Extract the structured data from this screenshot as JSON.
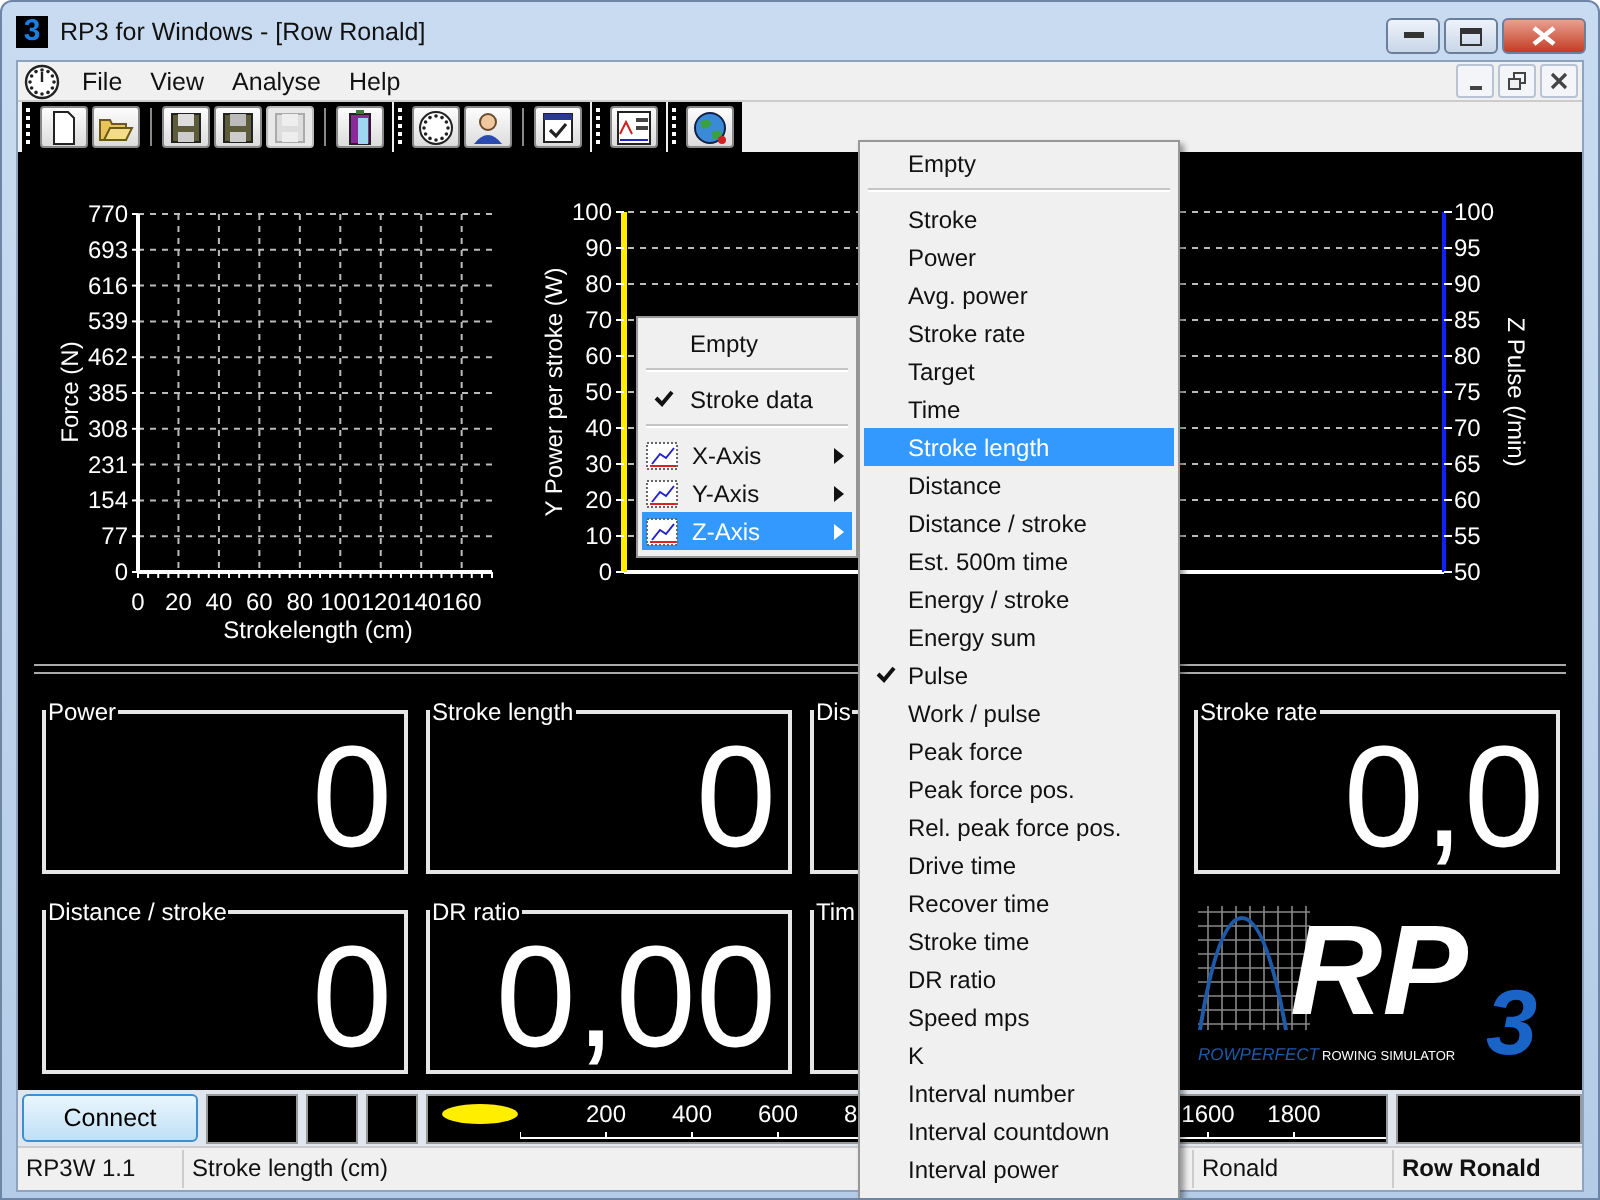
{
  "window": {
    "icon_glyph": "3",
    "title": "RP3 for Windows - [Row Ronald]"
  },
  "menu_bar": [
    {
      "label": "File"
    },
    {
      "label": "View"
    },
    {
      "label": "Analyse"
    },
    {
      "label": "Help"
    }
  ],
  "toolbar": [
    {
      "items": [
        {
          "kind": "new",
          "disabled": false
        },
        {
          "kind": "open",
          "disabled": false
        },
        {
          "kind": "separator"
        },
        {
          "kind": "save",
          "disabled": false
        },
        {
          "kind": "save-as",
          "disabled": false
        },
        {
          "kind": "save",
          "disabled": true
        },
        {
          "kind": "separator"
        },
        {
          "kind": "door",
          "disabled": false
        }
      ]
    },
    {
      "items": [
        {
          "kind": "gauge",
          "disabled": false
        },
        {
          "kind": "person",
          "disabled": false
        },
        {
          "kind": "separator"
        },
        {
          "kind": "checklist",
          "disabled": false
        }
      ]
    },
    {
      "items": [
        {
          "kind": "chart",
          "disabled": false
        }
      ]
    },
    {
      "items": [
        {
          "kind": "globe",
          "disabled": false
        }
      ]
    }
  ],
  "force_chart": {
    "chart_data": {
      "type": "line",
      "grid": true,
      "xlabel": "Strokelength (cm)",
      "ylabel": "Force (N)",
      "xlim": [
        0,
        175
      ],
      "ylim": [
        0,
        770
      ],
      "xticks": [
        0,
        20,
        40,
        60,
        80,
        100,
        120,
        140,
        160
      ],
      "yticks": [
        0,
        77,
        154,
        231,
        308,
        385,
        462,
        539,
        616,
        693,
        770
      ]
    }
  },
  "power_chart": {
    "chart_data": {
      "type": "line",
      "grid": true,
      "categories": [
        null
      ],
      "ylabel": "Y  Power per stroke (W)",
      "ylim": [
        0,
        100
      ],
      "yticks": [
        0,
        10,
        20,
        30,
        40,
        50,
        60,
        70,
        80,
        90,
        100
      ]
    },
    "z_axis": {
      "title": "Z Pulse (/min)",
      "ticks": [
        "100",
        "95",
        "90",
        "85",
        "80",
        "75",
        "70",
        "65",
        "60",
        "55",
        "50"
      ]
    }
  },
  "tiles": [
    {
      "kind": "full",
      "label": "Power",
      "value": "0"
    },
    {
      "kind": "full",
      "label": "Stroke length",
      "value": "0"
    },
    {
      "kind": "partial",
      "label": "Dis"
    },
    {
      "kind": "full",
      "label": "Stroke rate",
      "value": "0,0"
    },
    {
      "kind": "full",
      "label": "Distance / stroke",
      "value": "0"
    },
    {
      "kind": "full",
      "label": "DR ratio",
      "value": "0,00"
    },
    {
      "kind": "partial",
      "label": "Tim"
    }
  ],
  "logo": {
    "main": "RP",
    "brand": "ROWPERFECT",
    "tagline": "ROWING SIMULATOR",
    "sub": "3"
  },
  "bottom_bar": {
    "connect_button": "Connect",
    "ruler": {
      "start_labels": [
        "200",
        "400",
        "600",
        "8"
      ],
      "end_labels": [
        "1600",
        "1800"
      ]
    }
  },
  "status_bar": [
    {
      "kind": "normal",
      "text": "RP3W 1.1"
    },
    {
      "kind": "normal",
      "text": "Stroke length (cm)"
    },
    {
      "kind": "normal",
      "text": "Ronald"
    },
    {
      "kind": "bold",
      "text": "Row Ronald"
    }
  ],
  "context_menu": [
    {
      "kind": "item",
      "label": "Empty",
      "checked": false,
      "selected": false
    },
    {
      "kind": "separator"
    },
    {
      "kind": "item",
      "label": "Stroke data",
      "checked": true,
      "selected": false
    },
    {
      "kind": "separator"
    },
    {
      "kind": "submenu",
      "label": "X-Axis",
      "selected": false
    },
    {
      "kind": "submenu",
      "label": "Y-Axis",
      "selected": false
    },
    {
      "kind": "submenu",
      "label": "Z-Axis",
      "selected": true
    }
  ],
  "submenu": [
    {
      "kind": "item",
      "label": "Empty",
      "checked": false,
      "selected": false
    },
    {
      "kind": "separator"
    },
    {
      "kind": "item",
      "label": "Stroke",
      "checked": false,
      "selected": false
    },
    {
      "kind": "item",
      "label": "Power",
      "checked": false,
      "selected": false
    },
    {
      "kind": "item",
      "label": "Avg. power",
      "checked": false,
      "selected": false
    },
    {
      "kind": "item",
      "label": "Stroke rate",
      "checked": false,
      "selected": false
    },
    {
      "kind": "item",
      "label": "Target",
      "checked": false,
      "selected": false
    },
    {
      "kind": "item",
      "label": "Time",
      "checked": false,
      "selected": false
    },
    {
      "kind": "item",
      "label": "Stroke length",
      "checked": false,
      "selected": true
    },
    {
      "kind": "item",
      "label": "Distance",
      "checked": false,
      "selected": false
    },
    {
      "kind": "item",
      "label": "Distance / stroke",
      "checked": false,
      "selected": false
    },
    {
      "kind": "item",
      "label": "Est. 500m time",
      "checked": false,
      "selected": false
    },
    {
      "kind": "item",
      "label": "Energy / stroke",
      "checked": false,
      "selected": false
    },
    {
      "kind": "item",
      "label": "Energy sum",
      "checked": false,
      "selected": false
    },
    {
      "kind": "item",
      "label": "Pulse",
      "checked": true,
      "selected": false
    },
    {
      "kind": "item",
      "label": "Work / pulse",
      "checked": false,
      "selected": false
    },
    {
      "kind": "item",
      "label": "Peak force",
      "checked": false,
      "selected": false
    },
    {
      "kind": "item",
      "label": "Peak force pos.",
      "checked": false,
      "selected": false
    },
    {
      "kind": "item",
      "label": "Rel. peak force pos.",
      "checked": false,
      "selected": false
    },
    {
      "kind": "item",
      "label": "Drive time",
      "checked": false,
      "selected": false
    },
    {
      "kind": "item",
      "label": "Recover time",
      "checked": false,
      "selected": false
    },
    {
      "kind": "item",
      "label": "Stroke time",
      "checked": false,
      "selected": false
    },
    {
      "kind": "item",
      "label": "DR ratio",
      "checked": false,
      "selected": false
    },
    {
      "kind": "item",
      "label": "Speed mps",
      "checked": false,
      "selected": false
    },
    {
      "kind": "item",
      "label": "K",
      "checked": false,
      "selected": false
    },
    {
      "kind": "item",
      "label": "Interval number",
      "checked": false,
      "selected": false
    },
    {
      "kind": "item",
      "label": "Interval countdown",
      "checked": false,
      "selected": false
    },
    {
      "kind": "item",
      "label": "Interval power",
      "checked": false,
      "selected": false
    }
  ]
}
